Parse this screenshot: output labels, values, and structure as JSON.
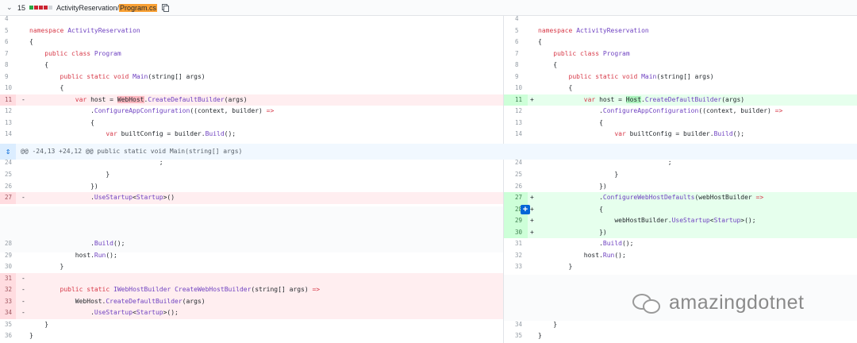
{
  "file_header": {
    "count": "15",
    "diffstat_colors": [
      "#28a745",
      "#cb2431",
      "#cb2431",
      "#cb2431",
      "#d1d5da"
    ],
    "path_prefix": "ActivityReservation/",
    "path_file": "Program.cs"
  },
  "hunk": {
    "text": "@@ -24,13 +24,12 @@ public static void Main(string[] args)"
  },
  "watermark": {
    "text": "amazingdotnet"
  },
  "left_lines": [
    {
      "n": "4",
      "m": "",
      "c": ""
    },
    {
      "n": "5",
      "m": "",
      "c": "namespace ActivityReservation"
    },
    {
      "n": "6",
      "m": "",
      "c": "{"
    },
    {
      "n": "7",
      "m": "",
      "c": "    public class Program"
    },
    {
      "n": "8",
      "m": "",
      "c": "    {"
    },
    {
      "n": "9",
      "m": "",
      "c": "        public static void Main(string[] args)"
    },
    {
      "n": "10",
      "m": "",
      "c": "        {"
    },
    {
      "n": "11",
      "m": "-",
      "c": "            var host = WebHost.CreateDefaultBuilder(args)"
    },
    {
      "n": "12",
      "m": "",
      "c": "                .ConfigureAppConfiguration((context, builder) =>"
    },
    {
      "n": "13",
      "m": "",
      "c": "                {"
    },
    {
      "n": "14",
      "m": "",
      "c": "                    var builtConfig = builder.Build();"
    },
    {
      "n": "24",
      "m": "",
      "c": "                                  ;"
    },
    {
      "n": "25",
      "m": "",
      "c": "                    }"
    },
    {
      "n": "26",
      "m": "",
      "c": "                })"
    },
    {
      "n": "27",
      "m": "-",
      "c": "                .UseStartup<Startup>()"
    },
    {
      "n": "28",
      "m": "",
      "c": "                .Build();"
    },
    {
      "n": "29",
      "m": "",
      "c": "            host.Run();"
    },
    {
      "n": "30",
      "m": "",
      "c": "        }"
    },
    {
      "n": "31",
      "m": "-",
      "c": ""
    },
    {
      "n": "32",
      "m": "-",
      "c": "        public static IWebHostBuilder CreateWebHostBuilder(string[] args) =>"
    },
    {
      "n": "33",
      "m": "-",
      "c": "            WebHost.CreateDefaultBuilder(args)"
    },
    {
      "n": "34",
      "m": "-",
      "c": "                .UseStartup<Startup>();"
    },
    {
      "n": "35",
      "m": "",
      "c": "    }"
    },
    {
      "n": "36",
      "m": "",
      "c": "}"
    }
  ],
  "right_lines": [
    {
      "n": "4",
      "m": "",
      "c": ""
    },
    {
      "n": "5",
      "m": "",
      "c": "namespace ActivityReservation"
    },
    {
      "n": "6",
      "m": "",
      "c": "{"
    },
    {
      "n": "7",
      "m": "",
      "c": "    public class Program"
    },
    {
      "n": "8",
      "m": "",
      "c": "    {"
    },
    {
      "n": "9",
      "m": "",
      "c": "        public static void Main(string[] args)"
    },
    {
      "n": "10",
      "m": "",
      "c": "        {"
    },
    {
      "n": "11",
      "m": "+",
      "c": "            var host = Host.CreateDefaultBuilder(args)"
    },
    {
      "n": "12",
      "m": "",
      "c": "                .ConfigureAppConfiguration((context, builder) =>"
    },
    {
      "n": "13",
      "m": "",
      "c": "                {"
    },
    {
      "n": "14",
      "m": "",
      "c": "                    var builtConfig = builder.Build();"
    },
    {
      "n": "24",
      "m": "",
      "c": "                                  ;"
    },
    {
      "n": "25",
      "m": "",
      "c": "                    }"
    },
    {
      "n": "26",
      "m": "",
      "c": "                })"
    },
    {
      "n": "27",
      "m": "+",
      "c": "                .ConfigureWebHostDefaults(webHostBuilder =>"
    },
    {
      "n": "28",
      "m": "+",
      "c": "                {"
    },
    {
      "n": "29",
      "m": "+",
      "c": "                    webHostBuilder.UseStartup<Startup>();"
    },
    {
      "n": "30",
      "m": "+",
      "c": "                })"
    },
    {
      "n": "31",
      "m": "",
      "c": "                .Build();"
    },
    {
      "n": "32",
      "m": "",
      "c": "            host.Run();"
    },
    {
      "n": "33",
      "m": "",
      "c": "        }"
    },
    {
      "n": "34",
      "m": "",
      "c": "    }"
    },
    {
      "n": "35",
      "m": "",
      "c": "}"
    }
  ]
}
